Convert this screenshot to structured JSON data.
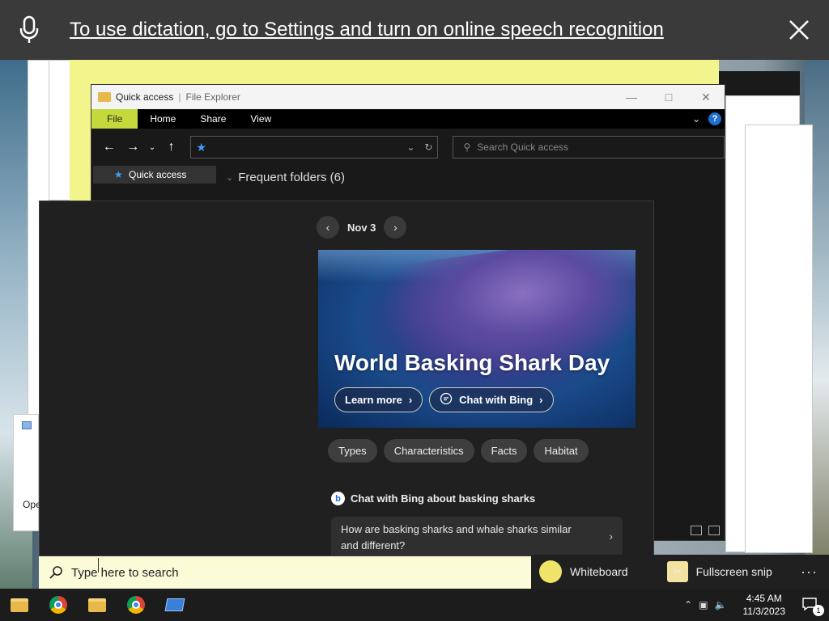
{
  "dictation": {
    "message": "To use dictation, go to Settings and turn on online speech recognition",
    "icons": {
      "mic": "microphone-icon",
      "close": "close-icon"
    }
  },
  "explorer": {
    "title_location": "Quick access",
    "title_app": "File Explorer",
    "ribbon_tabs": [
      "File",
      "Home",
      "Share",
      "View"
    ],
    "search_placeholder": "Search Quick access",
    "sidebar_item": "Quick access",
    "section_label": "Frequent folders (6)"
  },
  "side_window": {
    "label": "Ope"
  },
  "panel": {
    "date": "Nov 3",
    "hero_title": "World Basking Shark Day",
    "learn_more": "Learn more",
    "chat_with_bing": "Chat with Bing",
    "chips": [
      "Types",
      "Characteristics",
      "Facts",
      "Habitat"
    ],
    "bing_heading": "Chat with Bing about basking sharks",
    "bing_logo": "b",
    "question": "How are basking sharks and whale sharks similar and different?"
  },
  "searchbox": {
    "placeholder": "Type here to search"
  },
  "suggestions": [
    {
      "label": "Whiteboard",
      "icon": "whiteboard-icon"
    },
    {
      "label": "Fullscreen snip",
      "icon": "snip-icon"
    }
  ],
  "taskbar": {
    "apps": [
      "file-explorer-icon",
      "chrome-icon",
      "file-explorer-icon",
      "chrome-icon",
      "remote-desktop-icon"
    ],
    "time": "4:45 AM",
    "date": "11/3/2023",
    "notification_count": "1"
  },
  "colors": {
    "accent_yellow": "#c4da3c",
    "searchbox_bg": "#fbfbd8",
    "panel_bg": "#202020",
    "taskbar_bg": "#1c1c1c"
  }
}
